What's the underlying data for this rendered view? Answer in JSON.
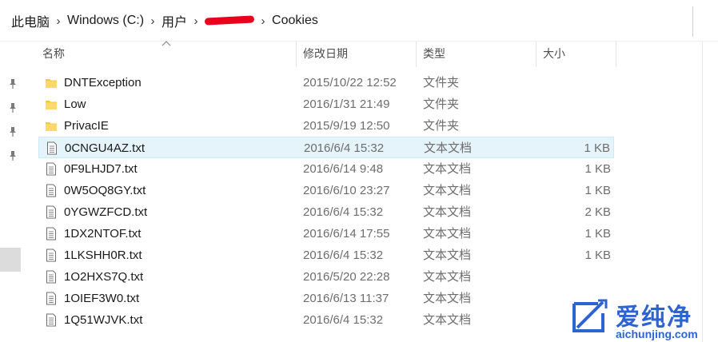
{
  "breadcrumb": [
    "此电脑",
    "Windows (C:)",
    "用户",
    "",
    "Cookies"
  ],
  "columns": {
    "name": "名称",
    "date": "修改日期",
    "type": "类型",
    "size": "大小"
  },
  "files": [
    {
      "name": "DNTException",
      "date": "2015/10/22 12:52",
      "type": "文件夹",
      "size": "",
      "icon": "folder-icon"
    },
    {
      "name": "Low",
      "date": "2016/1/31 21:49",
      "type": "文件夹",
      "size": "",
      "icon": "folder-icon"
    },
    {
      "name": "PrivacIE",
      "date": "2015/9/19 12:50",
      "type": "文件夹",
      "size": "",
      "icon": "folder-icon"
    },
    {
      "name": "0CNGU4AZ.txt",
      "date": "2016/6/4 15:32",
      "type": "文本文档",
      "size": "1 KB",
      "icon": "text-file-icon",
      "selected": true
    },
    {
      "name": "0F9LHJD7.txt",
      "date": "2016/6/14 9:48",
      "type": "文本文档",
      "size": "1 KB",
      "icon": "text-file-icon"
    },
    {
      "name": "0W5OQ8GY.txt",
      "date": "2016/6/10 23:27",
      "type": "文本文档",
      "size": "1 KB",
      "icon": "text-file-icon"
    },
    {
      "name": "0YGWZFCD.txt",
      "date": "2016/6/4 15:32",
      "type": "文本文档",
      "size": "2 KB",
      "icon": "text-file-icon"
    },
    {
      "name": "1DX2NTOF.txt",
      "date": "2016/6/14 17:55",
      "type": "文本文档",
      "size": "1 KB",
      "icon": "text-file-icon"
    },
    {
      "name": "1LKSHH0R.txt",
      "date": "2016/6/4 15:32",
      "type": "文本文档",
      "size": "1 KB",
      "icon": "text-file-icon"
    },
    {
      "name": "1O2HXS7Q.txt",
      "date": "2016/5/20 22:28",
      "type": "文本文档",
      "size": "",
      "icon": "text-file-icon"
    },
    {
      "name": "1OIEF3W0.txt",
      "date": "2016/6/13 11:37",
      "type": "文本文档",
      "size": "",
      "icon": "text-file-icon"
    },
    {
      "name": "1Q51WJVK.txt",
      "date": "2016/6/4 15:32",
      "type": "文本文档",
      "size": "",
      "icon": "text-file-icon"
    }
  ],
  "watermark": {
    "text": "爱纯净",
    "url": "aichunjing.com"
  },
  "colors": {
    "selection": "#e5f3fb",
    "folder": "#f6c844",
    "watermark": "#2e64d2",
    "redaction": "#e8001c"
  }
}
